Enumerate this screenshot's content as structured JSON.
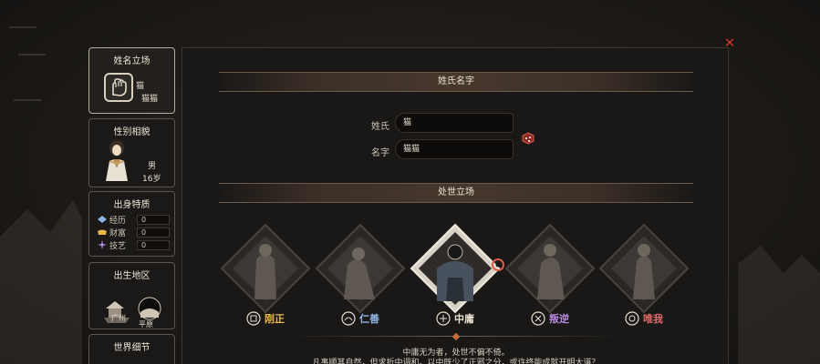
{
  "colors": {
    "accent": "#c33a3a",
    "panel_border": "#5d564d",
    "section_bar": "#47382d",
    "zhengzhi": "#e8b84a",
    "renshan": "#8fb7e6",
    "zhongyong": "#e8e0d0",
    "panni": "#b98ae6",
    "weiwo": "#e06a6a"
  },
  "sidebar": {
    "name_panel": {
      "title": "姓名立场",
      "surname": "猫",
      "given_name": "猫猫",
      "icon": "fist-badge-icon"
    },
    "gender_panel": {
      "title": "性别相貌",
      "gender": "男",
      "age": "16岁"
    },
    "origin_panel": {
      "title": "出身特质",
      "stats": [
        {
          "icon": "experience-gem-icon",
          "label": "经历",
          "value": "0"
        },
        {
          "icon": "wealth-ingot-icon",
          "label": "财富",
          "value": "0"
        },
        {
          "icon": "skill-art-icon",
          "label": "技艺",
          "value": "0"
        }
      ]
    },
    "birthplace_panel": {
      "title": "出生地区",
      "city": "广州",
      "terrain": "平原"
    },
    "world_panel": {
      "title": "世界细节"
    }
  },
  "main": {
    "name_section": {
      "title": "姓氏名字",
      "surname_label": "姓氏",
      "surname_value": "猫",
      "given_label": "名字",
      "given_value": "猫猫"
    },
    "stance_section": {
      "title": "处世立场",
      "stances": [
        {
          "key": "zhengzhi",
          "label": "刚正",
          "icon": "upright-seal-icon",
          "selected": false
        },
        {
          "key": "renshan",
          "label": "仁善",
          "icon": "benevolence-seal-icon",
          "selected": false
        },
        {
          "key": "zhongyong",
          "label": "中庸",
          "icon": "moderate-seal-icon",
          "selected": true
        },
        {
          "key": "panni",
          "label": "叛逆",
          "icon": "rebel-seal-icon",
          "selected": false
        },
        {
          "key": "weiwo",
          "label": "唯我",
          "icon": "egoist-seal-icon",
          "selected": false
        }
      ],
      "description_line1": "中庸无为者，处世不偏不倚。",
      "description_line2": "凡事顺其自然，但求折中调和。以中既少了正邪之分，或许终能成就开明大道？"
    }
  },
  "window": {
    "close_glyph": "✕"
  }
}
